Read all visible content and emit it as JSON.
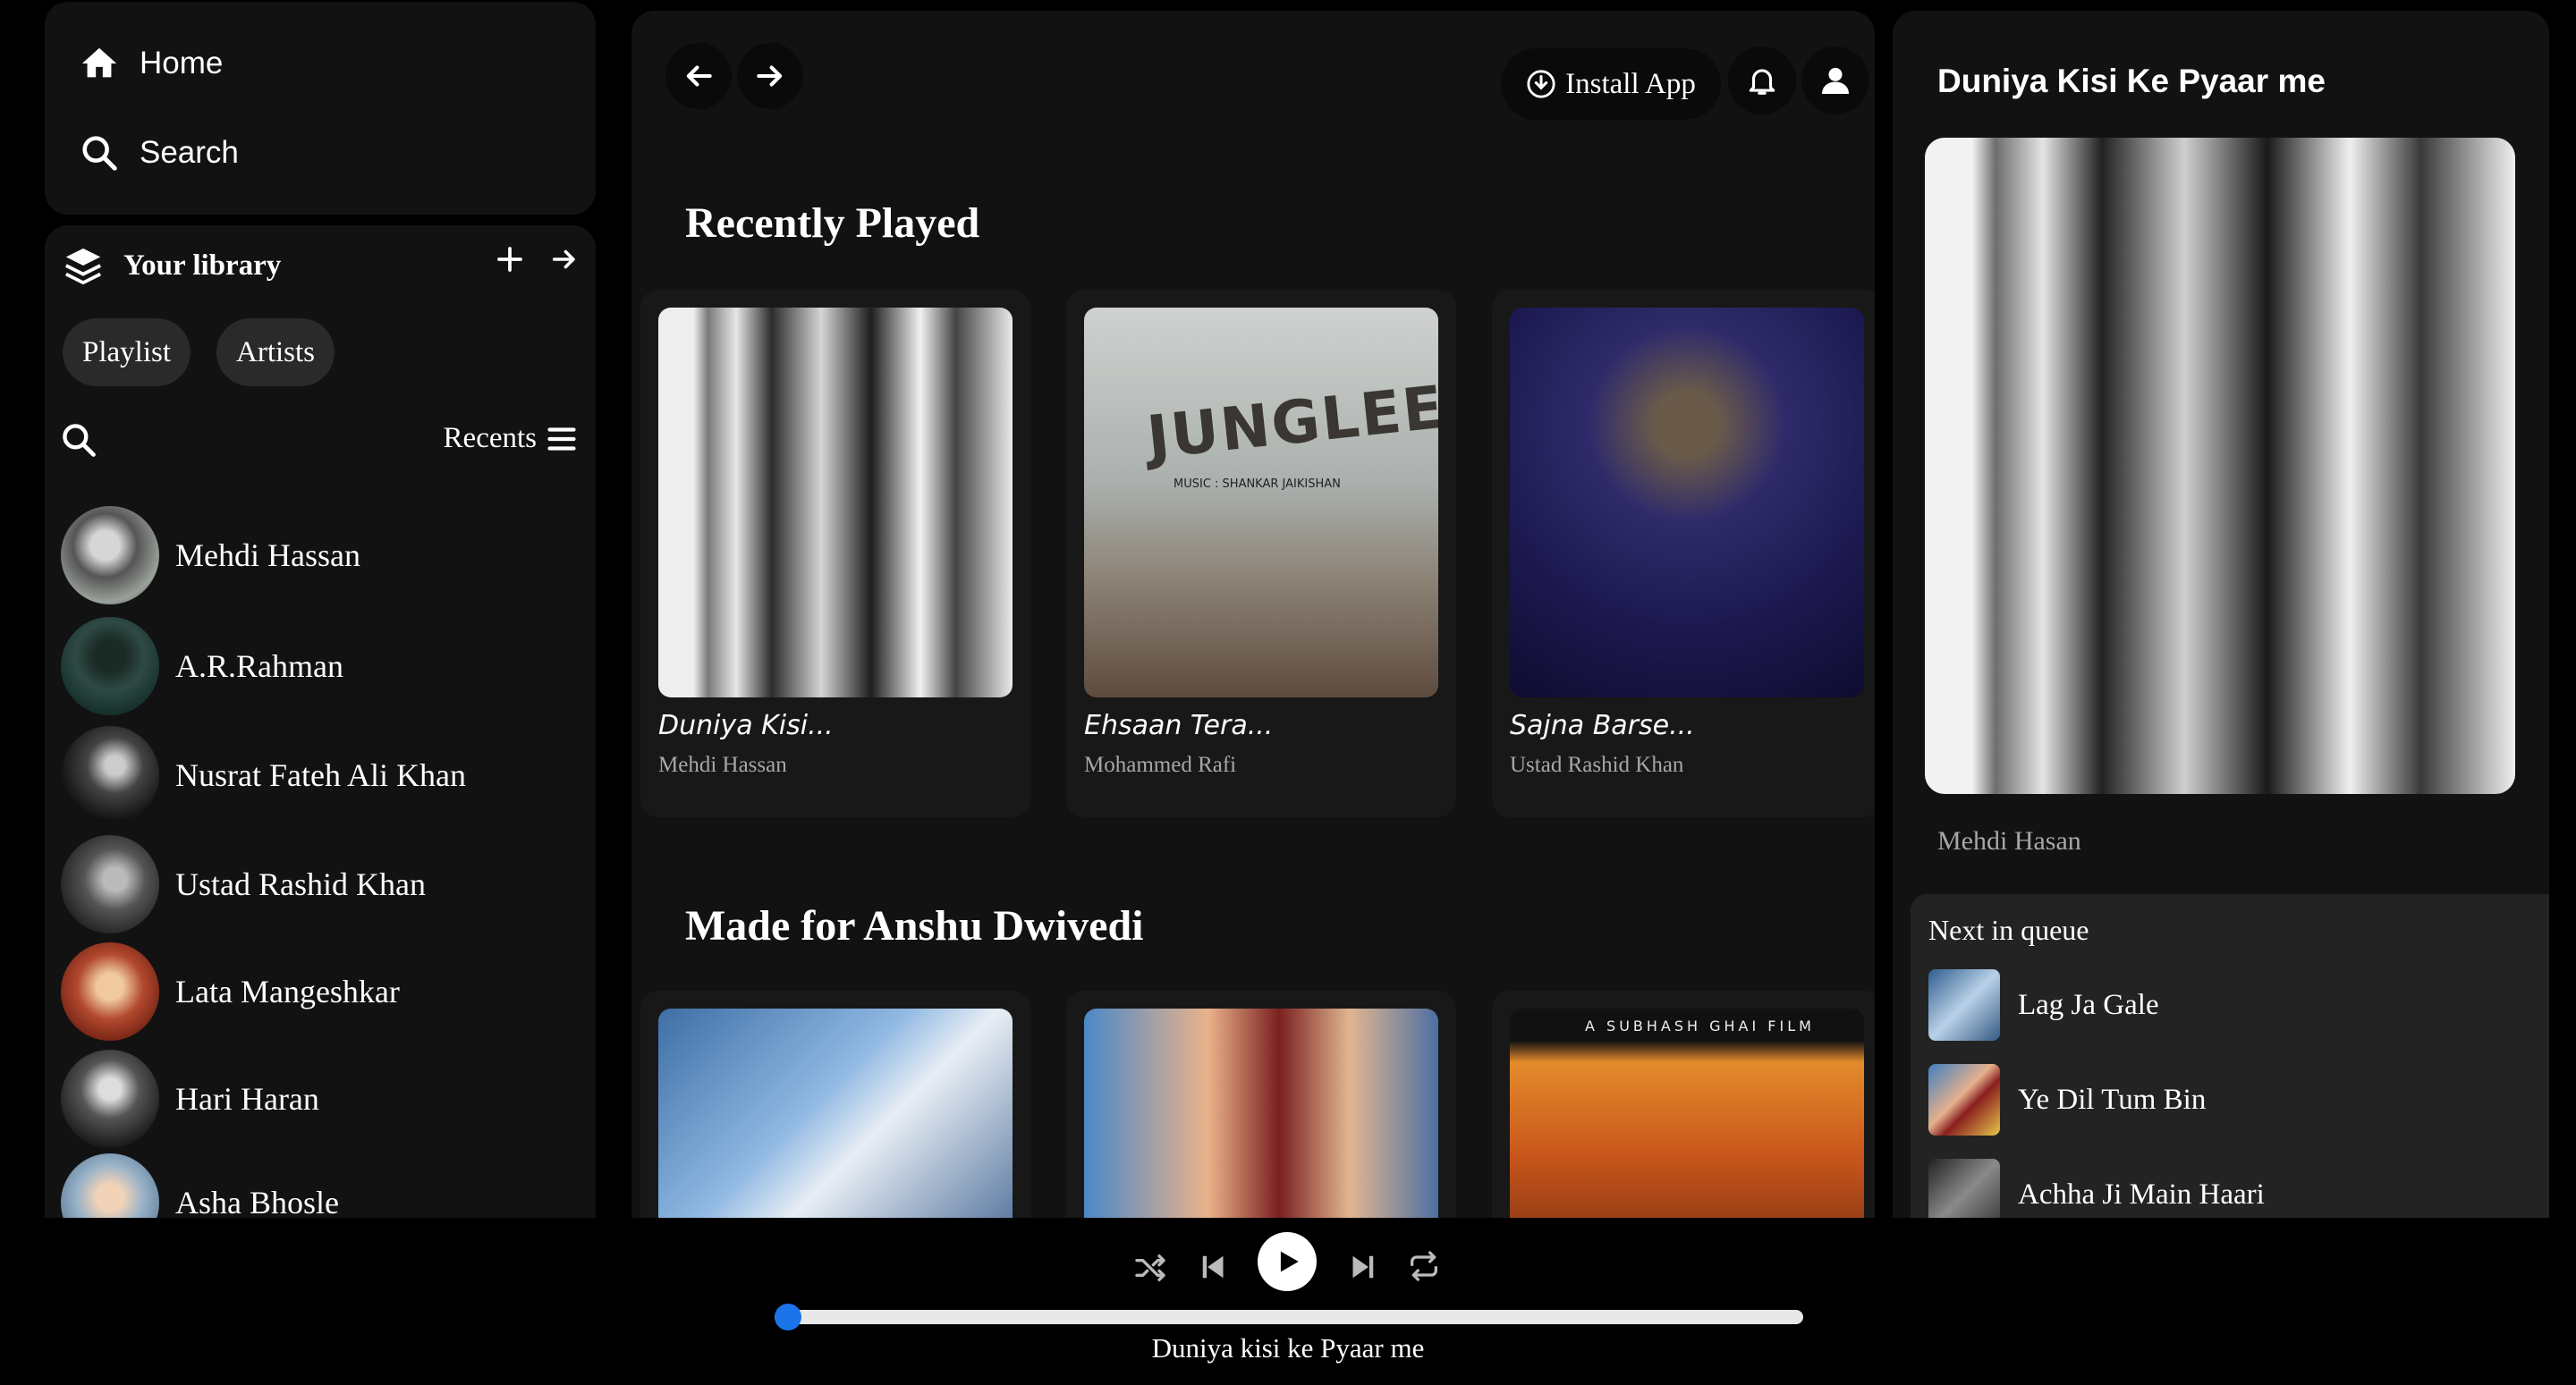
{
  "nav": {
    "home": "Home",
    "search": "Search"
  },
  "library": {
    "title": "Your library",
    "chips": [
      "Playlist",
      "Artists"
    ],
    "recents": "Recents",
    "artists": [
      "Mehdi Hassan",
      "A.R.Rahman",
      "Nusrat Fateh Ali Khan",
      "Ustad Rashid Khan",
      "Lata Mangeshkar",
      "Hari Haran",
      "Asha Bhosle"
    ]
  },
  "header": {
    "install": "Install App"
  },
  "sections": {
    "recently_played": {
      "title": "Recently Played",
      "cards": [
        {
          "title": "Duniya Kisi...",
          "artist": "Mehdi Hassan"
        },
        {
          "title": "Ehsaan Tera...",
          "artist": "Mohammed Rafi"
        },
        {
          "title": "Sajna Barse...",
          "artist": "Ustad Rashid Khan"
        }
      ],
      "album_text": {
        "junglee": "JUNGLEE",
        "music_credit": "MUSIC : SHANKAR JAIKISHAN"
      }
    },
    "made_for": {
      "title": "Made for Anshu Dwivedi",
      "film_banner": "A SUBHASH GHAI FILM"
    }
  },
  "now_playing": {
    "title": "Duniya Kisi Ke Pyaar me",
    "artist": "Mehdi Hasan",
    "queue_title": "Next in queue",
    "queue": [
      "Lag Ja Gale",
      "Ye Dil Tum Bin",
      "Achha Ji Main Haari"
    ]
  },
  "player": {
    "track": "Duniya kisi ke Pyaar me",
    "progress": 0.0,
    "accent": "#1a73e8"
  }
}
